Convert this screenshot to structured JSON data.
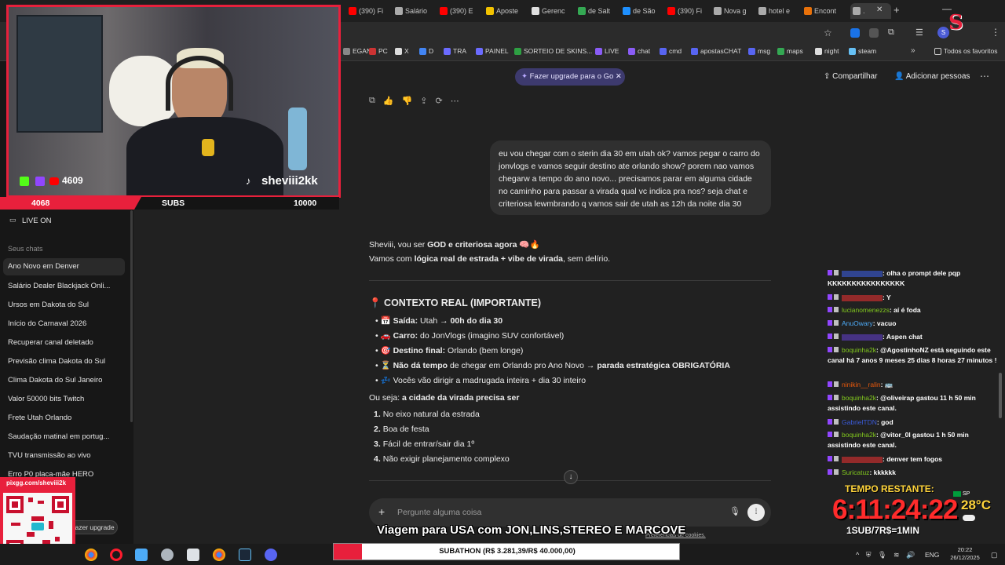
{
  "browser": {
    "tabs": [
      {
        "label": "(390) Fi",
        "color": "#ff0000"
      },
      {
        "label": "Salário",
        "color": "#aaaaaa"
      },
      {
        "label": "(390) E",
        "color": "#ff0000"
      },
      {
        "label": "Aposte",
        "color": "#f2c200"
      },
      {
        "label": "Gerenc",
        "color": "#e0e0e0"
      },
      {
        "label": "de Salt",
        "color": "#34a853"
      },
      {
        "label": "de São",
        "color": "#1e90ff"
      },
      {
        "label": "(390) Fi",
        "color": "#ff0000"
      },
      {
        "label": "Nova g",
        "color": "#aaaaaa"
      },
      {
        "label": "hotel e",
        "color": "#aaaaaa"
      },
      {
        "label": "Encont",
        "color": "#e8710a"
      },
      {
        "label": ".",
        "color": "#aaaaaa"
      }
    ],
    "bookmarks": [
      {
        "label": "EGAN",
        "color": "#888888"
      },
      {
        "label": "PC",
        "color": "#cc3333"
      },
      {
        "label": "X",
        "color": "#dddddd"
      },
      {
        "label": "D",
        "color": "#4285f4"
      },
      {
        "label": "TRA",
        "color": "#6b6bff"
      },
      {
        "label": "PAINEL",
        "color": "#6b6bff"
      },
      {
        "label": "SORTEIO DE SKINS...",
        "color": "#2ea043"
      },
      {
        "label": "LIVE",
        "color": "#8a5cf6"
      },
      {
        "label": "chat",
        "color": "#8a5cf6"
      },
      {
        "label": "cmd",
        "color": "#5865f2"
      },
      {
        "label": "apostasCHAT",
        "color": "#5865f2"
      },
      {
        "label": "msg",
        "color": "#5865f2"
      },
      {
        "label": "maps",
        "color": "#34a853"
      },
      {
        "label": "night",
        "color": "#dddddd"
      },
      {
        "label": "steam",
        "color": "#66c0f4"
      }
    ],
    "all_favorites": "Todos os favoritos"
  },
  "sidebar": {
    "live_on": "LIVE ON",
    "section_title": "Seus chats",
    "chats": [
      "Ano Novo em Denver",
      "Salário Dealer Blackjack Onli...",
      "Ursos em Dakota do Sul",
      "Início do Carnaval 2026",
      "Recuperar canal deletado",
      "Previsão clima Dakota do Sul",
      "Clima Dakota do Sul Janeiro",
      "Valor 50000 bits Twitch",
      "Frete Utah Orlando",
      "Saudação matinal em portug...",
      "TVU transmissão ao vivo",
      "Erro P0 placa-mãe HERO"
    ],
    "upgrade": "Fazer upgrade"
  },
  "header": {
    "upgrade_pill": "Fazer upgrade para o Go",
    "share": "Compartilhar",
    "add_people": "Adicionar pessoas"
  },
  "conversation": {
    "user_message": "eu vou chegar com o sterin dia 30 em utah ok? vamos pegar o carro do jonvlogs e vamos seguir destino ate orlando show? porem nao vamos chegarw a tempo do ano novo... precisamos parar em alguma cidade no caminho para passar a virada qual vc indica pra nos? seja chat e criteriosa lewmbrando q vamos sair de utah as 12h da noite dia 30",
    "intro_1a": "Sheviii, vou ser ",
    "intro_1b": "GOD e criteriosa agora",
    "intro_1c": " 🧠🔥",
    "intro_2a": "Vamos com ",
    "intro_2b": "lógica real de estrada + vibe de virada",
    "intro_2c": ", sem delírio.",
    "heading": "📍 CONTEXTO REAL (IMPORTANTE)",
    "bullets": [
      {
        "icon": "📅",
        "bold": "Saída:",
        "text": " Utah → ",
        "bold2": "00h do dia 30"
      },
      {
        "icon": "🚗",
        "bold": "Carro:",
        "text": " do JonVlogs (imagino SUV confortável)",
        "bold2": ""
      },
      {
        "icon": "🎯",
        "bold": "Destino final:",
        "text": " Orlando (bem longe)",
        "bold2": ""
      },
      {
        "icon": "⏳",
        "bold": "Não dá tempo",
        "text": " de chegar em Orlando pro Ano Novo → ",
        "bold2": "parada estratégica OBRIGATÓRIA"
      },
      {
        "icon": "💤",
        "bold": "",
        "text": "Vocês vão dirigir a madrugada inteira + dia 30 inteiro",
        "bold2": ""
      }
    ],
    "ou_seja_a": "Ou seja: ",
    "ou_seja_b": "a cidade da virada precisa ser",
    "numbered": [
      "No eixo natural da estrada",
      "Boa de festa",
      "Fácil de entrar/sair dia 1º",
      "Não exigir planejamento complexo"
    ],
    "composer_placeholder": "Pergunte alguma coisa",
    "cookie_text": "Preferências de cookies."
  },
  "stream": {
    "handle": "sheviii2kk",
    "kick_count": "4609",
    "counter_left": "4068",
    "subs_label": "SUBS",
    "subs_goal": "10000",
    "qr_label": "pixgg.com/sheviii2k",
    "banner": "Viagem para USA com JON,LINS,STEREO E MARCOVE",
    "subathon": "SUBATHON (R$ 3.281,39/R$ 40.000,00)",
    "timer_label": "TEMPO RESTANTE:",
    "timer_value": "6:11:24:22",
    "timer_rule": "1SUB/7R$=1MIN",
    "weather_city": "SP",
    "temperature": "28°C"
  },
  "twitch_chat": [
    {
      "user": "",
      "user_color": "#3b5bdb",
      "text": ": olha o prompt dele pqp KKKKKKKKKKKKKKKK"
    },
    {
      "user": "",
      "user_color": "#e03131",
      "text": ": Y"
    },
    {
      "user": "lucianomenezzs",
      "user_color": "#82c91e",
      "text": ": aí é foda"
    },
    {
      "user": "AnuOwary",
      "user_color": "#4dabf7",
      "text": ": vacuo"
    },
    {
      "user": "",
      "user_color": "#5f3dc4",
      "text": ": Aspen chat"
    },
    {
      "user": "boquinha2k",
      "user_color": "#82c91e",
      "text": ": @AgostinhoNZ está seguindo este canal há 7 anos 9 meses 25 dias 8 horas 27 minutos !"
    },
    {
      "user": "ninikin__ralin",
      "user_color": "#e8590c",
      "text": ": 🚌"
    },
    {
      "user": "boquinha2k",
      "user_color": "#82c91e",
      "text": ": @oliveirap gastou 11 h 50 min assistindo este canal."
    },
    {
      "user": "GabrielTDN",
      "user_color": "#3b5bdb",
      "text": ": god"
    },
    {
      "user": "boquinha2k",
      "user_color": "#82c91e",
      "text": ": @vitor_0l gastou 1 h 50 min assistindo este canal."
    },
    {
      "user": "",
      "user_color": "#e03131",
      "text": ": denver tem fogos"
    },
    {
      "user": "Suricatuz",
      "user_color": "#82c91e",
      "text": ": kkkkkk"
    }
  ],
  "taskbar": {
    "lang": "ENG",
    "time": "20:22",
    "date": "26/12/2025"
  }
}
